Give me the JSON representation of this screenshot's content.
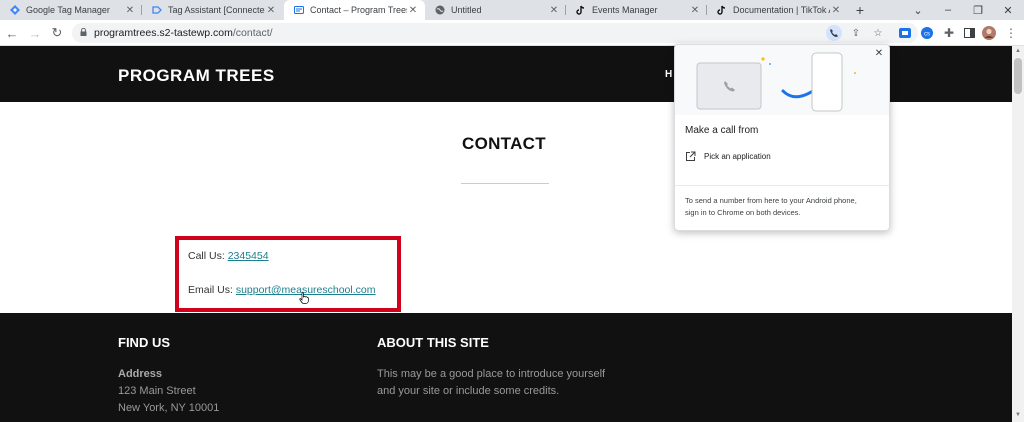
{
  "browser": {
    "tabs": [
      {
        "title": "Google Tag Manager",
        "icon": "gtm-icon",
        "active": false
      },
      {
        "title": "Tag Assistant [Connected]",
        "icon": "tag-assistant-icon",
        "active": false
      },
      {
        "title": "Contact – Program Trees",
        "icon": "site-icon",
        "active": true
      },
      {
        "title": "Untitled",
        "icon": "globe-icon",
        "active": false
      },
      {
        "title": "Events Manager",
        "icon": "tiktok-icon",
        "active": false
      },
      {
        "title": "Documentation | TikTok AP",
        "icon": "tiktok-icon",
        "active": false
      }
    ],
    "url_host": "programtrees.s2-tastewp.com",
    "url_path": "/contact/"
  },
  "site": {
    "title": "PROGRAM TREES",
    "nav_partial": "H"
  },
  "page": {
    "heading": "CONTACT",
    "call_label": "Call Us: ",
    "call_number": "2345454",
    "email_label": "Email Us: ",
    "email_address": "support@measureschool.com"
  },
  "footer": {
    "find_us_heading": "FIND US",
    "address_label": "Address",
    "address_line1": "123 Main Street",
    "address_line2": "New York, NY 10001",
    "about_heading": "ABOUT THIS SITE",
    "about_line1": "This may be a good place to introduce yourself",
    "about_line2": "and your site or include some credits."
  },
  "popup": {
    "title": "Make a call from",
    "option": "Pick an application",
    "note_line1": "To send a number from here to your Android phone,",
    "note_line2": "sign in to Chrome on both devices."
  },
  "colors": {
    "highlight_border": "#d0021b",
    "link": "#1a7f8e",
    "header_bg": "#111111"
  }
}
